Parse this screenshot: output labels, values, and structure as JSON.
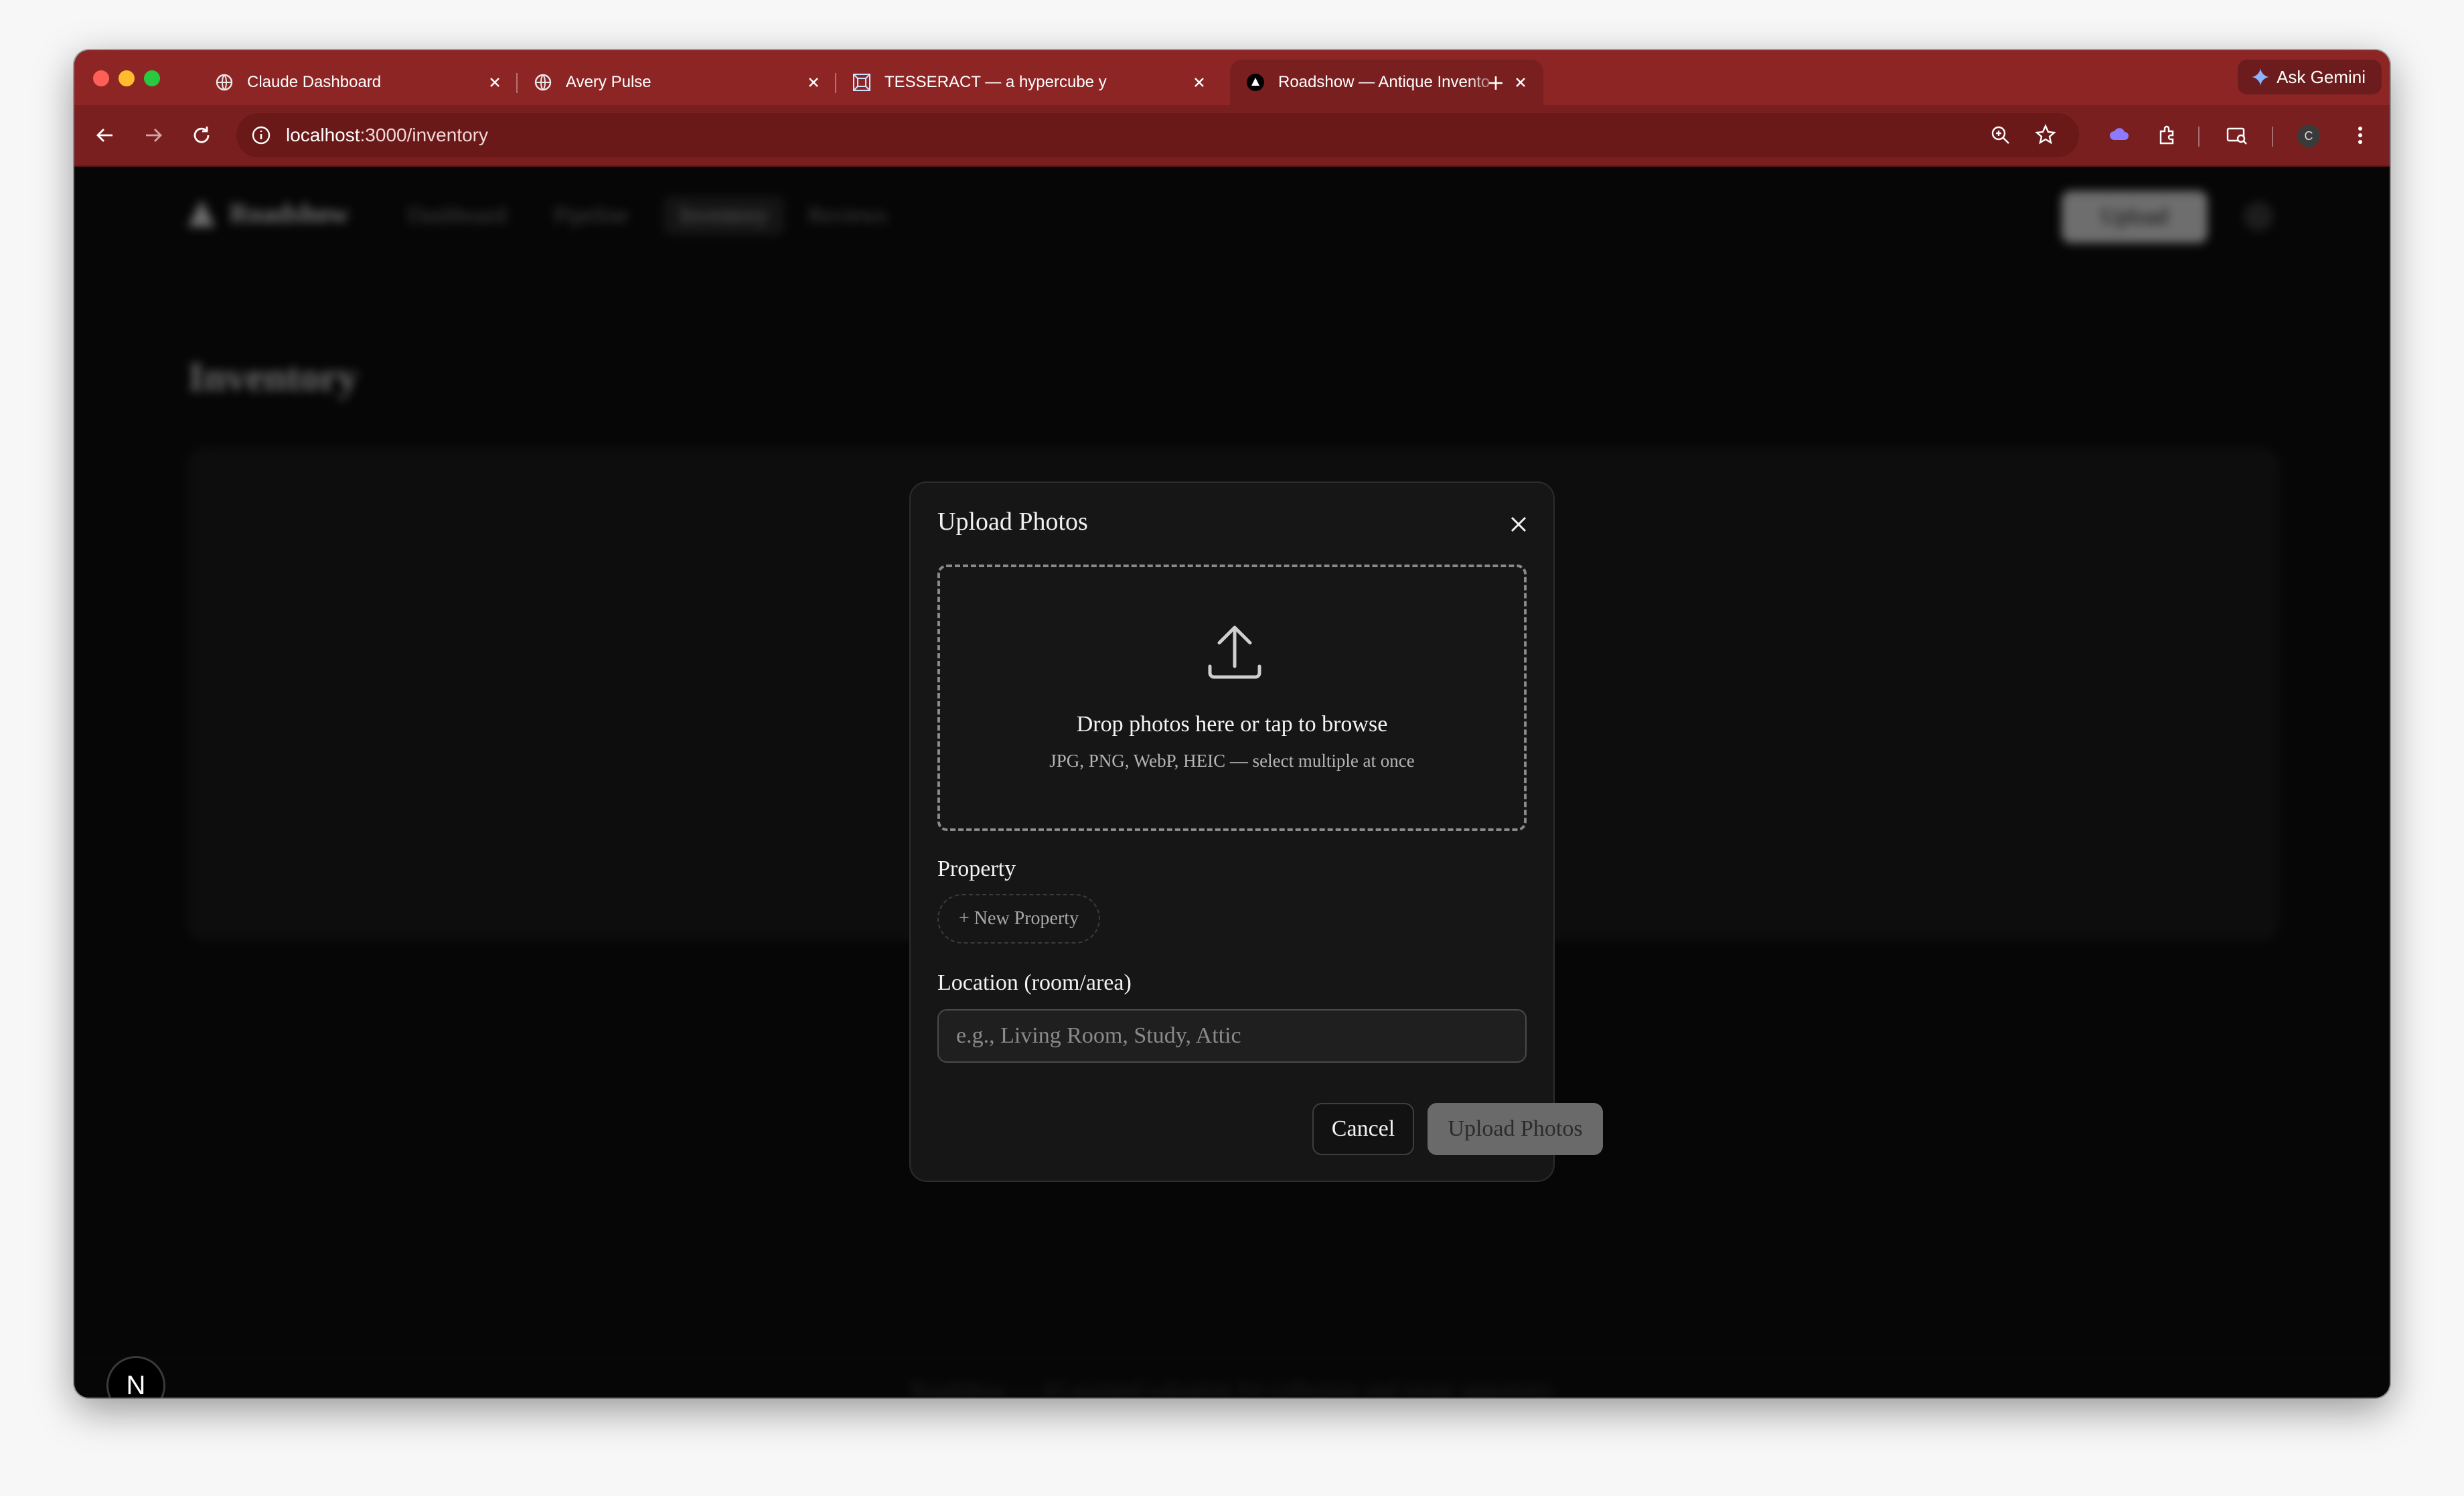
{
  "browser": {
    "tabs": [
      {
        "title": "Claude Dashboard",
        "favicon": "globe-icon",
        "active": false
      },
      {
        "title": "Avery Pulse",
        "favicon": "globe-icon",
        "active": false
      },
      {
        "title": "TESSERACT — a hypercube y",
        "favicon": "tesseract-icon",
        "active": false
      },
      {
        "title": "Roadshow — Antique Invento",
        "favicon": "triangle-logo-icon",
        "active": true
      }
    ],
    "gemini_label": "Ask Gemini",
    "url_host": "localhost",
    "url_path": ":3000/inventory",
    "profile_initial": "C",
    "accent_color": "#8e2525"
  },
  "app": {
    "brand": "Roadshow",
    "nav": [
      "Dashboard",
      "Pipeline",
      "Inventory",
      "Reviews"
    ],
    "upload_button": "Upload",
    "page_heading": "Inventory",
    "footer": "Roadshow — AI-assisted valuation for collectors and estate appraisers"
  },
  "modal": {
    "title": "Upload Photos",
    "dropzone_title": "Drop photos here or tap to browse",
    "dropzone_hint": "JPG, PNG, WebP, HEIC — select multiple at once",
    "property_label": "Property",
    "new_property_button": "+ New Property",
    "location_label": "Location (room/area)",
    "location_placeholder": "e.g., Living Room, Study, Attic",
    "location_value": "",
    "cancel_label": "Cancel",
    "submit_label": "Upload Photos"
  },
  "devtools_badge": "N"
}
